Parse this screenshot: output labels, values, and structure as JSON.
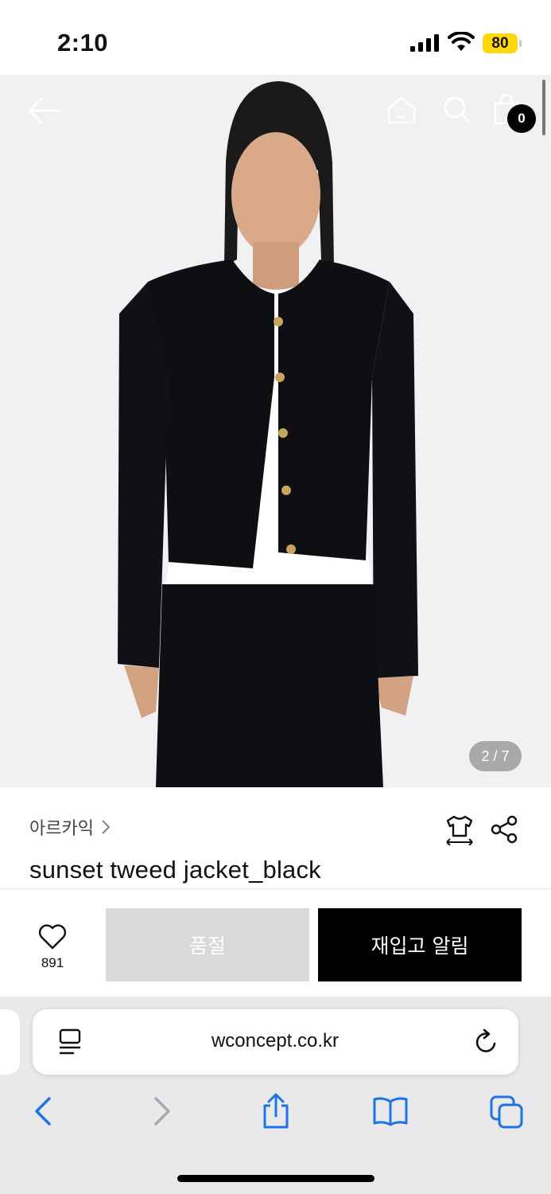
{
  "status_bar": {
    "time": "2:10",
    "battery": "80",
    "battery_color": "#ffd60a"
  },
  "header": {
    "back_icon": "arrow-left-icon",
    "home_icon": "home-icon",
    "search_icon": "search-icon",
    "bag_icon": "shopping-bag-icon",
    "cart_count": "0"
  },
  "gallery": {
    "counter": "2 / 7"
  },
  "product": {
    "brand": "아르카익",
    "name": "sunset tweed jacket_black"
  },
  "actions": {
    "like_count": "891",
    "soldout_label": "품절",
    "restock_label": "재입고 알림",
    "soldout_color": "#d9d9d9",
    "restock_color": "#000000"
  },
  "browser": {
    "url": "wconcept.co.kr",
    "accent": "#1a73e8"
  }
}
